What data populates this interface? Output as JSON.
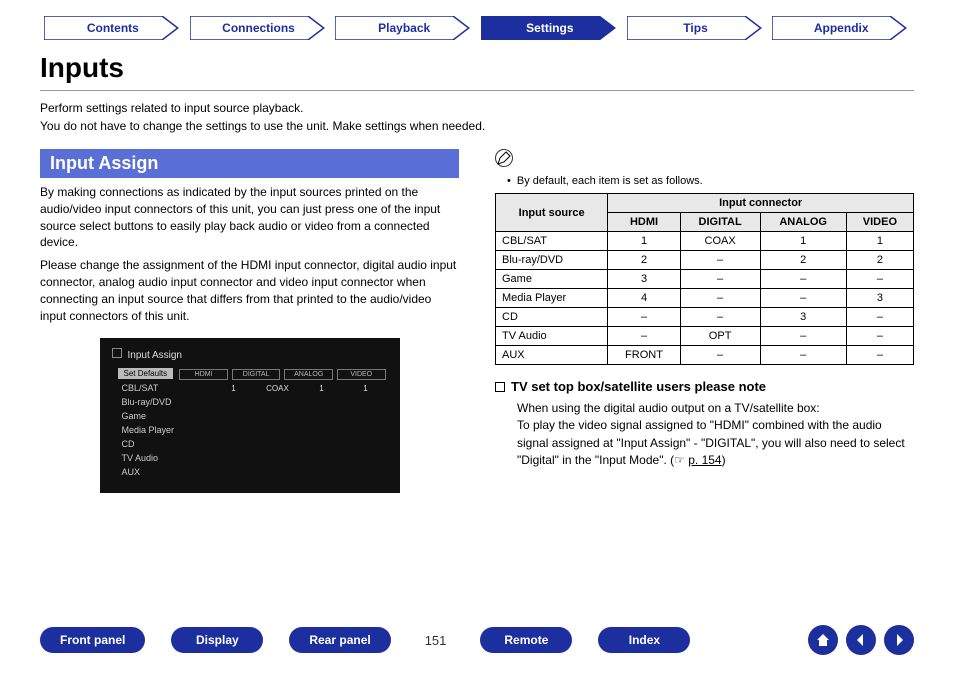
{
  "nav": {
    "tabs": [
      "Contents",
      "Connections",
      "Playback",
      "Settings",
      "Tips",
      "Appendix"
    ],
    "active_index": 3
  },
  "title": "Inputs",
  "intro1": "Perform settings related to input source playback.",
  "intro2": "You do not have to change the settings to use the unit. Make settings when needed.",
  "section": {
    "heading": "Input Assign",
    "para1": "By making connections as indicated by the input sources printed on the audio/video input connectors of this unit, you can just press one of the input source select buttons to easily play back audio or video from a connected device.",
    "para2": "Please change the assignment of the HDMI input connector, digital audio input connector, analog audio input connector and video input connector when connecting an input source that differs from that printed to the audio/video input connectors of this unit."
  },
  "screenshot": {
    "title": "Input Assign",
    "set_defaults": "Set Defaults",
    "hcols": [
      "HDMI",
      "DIGITAL",
      "ANALOG",
      "VIDEO"
    ],
    "rows": [
      {
        "label": "CBL/SAT",
        "vals": [
          "1",
          "COAX",
          "1",
          "1"
        ]
      },
      {
        "label": "Blu-ray/DVD",
        "vals": [
          "",
          "",
          "",
          ""
        ]
      },
      {
        "label": "Game",
        "vals": [
          "",
          "",
          "",
          ""
        ]
      },
      {
        "label": "Media Player",
        "vals": [
          "",
          "",
          "",
          ""
        ]
      },
      {
        "label": "CD",
        "vals": [
          "",
          "",
          "",
          ""
        ]
      },
      {
        "label": "TV Audio",
        "vals": [
          "",
          "",
          "",
          ""
        ]
      },
      {
        "label": "AUX",
        "vals": [
          "",
          "",
          "",
          ""
        ]
      }
    ]
  },
  "right": {
    "note": "By default, each item is set as follows.",
    "table": {
      "head_source": "Input source",
      "head_connector": "Input connector",
      "cols": [
        "HDMI",
        "DIGITAL",
        "ANALOG",
        "VIDEO"
      ],
      "rows": [
        {
          "src": "CBL/SAT",
          "vals": [
            "1",
            "COAX",
            "1",
            "1"
          ]
        },
        {
          "src": "Blu-ray/DVD",
          "vals": [
            "2",
            "–",
            "2",
            "2"
          ]
        },
        {
          "src": "Game",
          "vals": [
            "3",
            "–",
            "–",
            "–"
          ]
        },
        {
          "src": "Media Player",
          "vals": [
            "4",
            "–",
            "–",
            "3"
          ]
        },
        {
          "src": "CD",
          "vals": [
            "–",
            "–",
            "3",
            "–"
          ]
        },
        {
          "src": "TV Audio",
          "vals": [
            "–",
            "OPT",
            "–",
            "–"
          ]
        },
        {
          "src": "AUX",
          "vals": [
            "FRONT",
            "–",
            "–",
            "–"
          ]
        }
      ]
    },
    "sub_heading": "TV set top box/satellite users please note",
    "sub_line1": "When using the digital audio output on a TV/satellite box:",
    "sub_line2a": "To play the video signal assigned to \"HDMI\" combined with the audio signal assigned at \"Input Assign\" - \"DIGITAL\", you will also need to select \"Digital\" in the \"Input Mode\".  (",
    "sub_link": "p. 154",
    "sub_line2b": ")"
  },
  "bottom": {
    "buttons": [
      "Front panel",
      "Display",
      "Rear panel"
    ],
    "page_number": "151",
    "buttons2": [
      "Remote",
      "Index"
    ]
  }
}
